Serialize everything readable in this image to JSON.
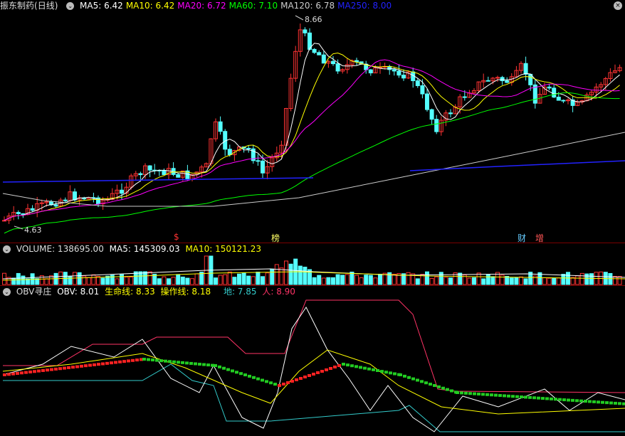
{
  "main": {
    "stock_name": "振东制药",
    "period": "(日线)",
    "ma_labels": [
      {
        "text": "MA5: 6.42",
        "color": "#ffffff"
      },
      {
        "text": "MA10: 6.42",
        "color": "#ffff00"
      },
      {
        "text": "MA20: 6.72",
        "color": "#ff00ff"
      },
      {
        "text": "MA60: 7.10",
        "color": "#00ff00"
      },
      {
        "text": "MA120: 6.78",
        "color": "#cccccc"
      },
      {
        "text": "MA250: 8.00",
        "color": "#2222ff"
      }
    ],
    "high_label": "8.66",
    "low_label": "4.63",
    "events": [
      {
        "text": "$",
        "color": "#ff3333"
      },
      {
        "text": "榜",
        "color": "#ffff66"
      },
      {
        "text": "财",
        "color": "#66ccff"
      },
      {
        "text": "增",
        "color": "#ff5555"
      }
    ],
    "up_color": "#ff3333",
    "down_color": "#54ffff"
  },
  "volume": {
    "label": "VOLUME: 138695.00",
    "ma5": "MA5: 145309.03",
    "ma10": "MA10: 150121.23"
  },
  "obv": {
    "name": "OBV寻庄",
    "obv": "OBV: 8.01",
    "life": "生命线: 8.33",
    "op": "操作线: 8.18",
    "di": "地: 7.85",
    "ren": "人: 8.90"
  }
}
